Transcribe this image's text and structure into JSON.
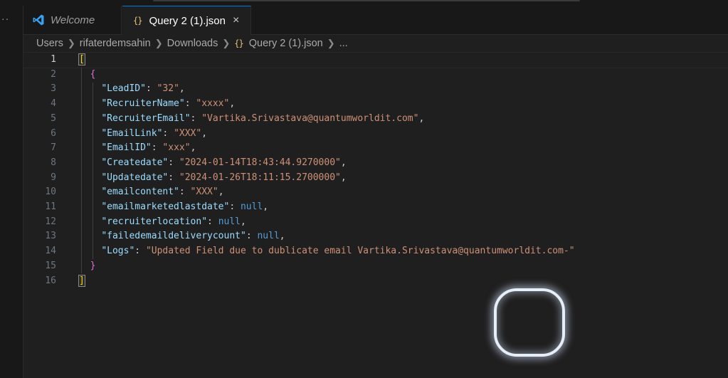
{
  "tabs": [
    {
      "label": "Welcome",
      "active": false
    },
    {
      "label": "Query 2 (1).json",
      "active": true,
      "close": "×"
    }
  ],
  "activity_dots": "··",
  "breadcrumb": [
    "Users",
    "rifaterdemsahin",
    "Downloads",
    "Query 2 (1).json",
    "..."
  ],
  "file_icon": "{}",
  "editor": {
    "lines": [
      {
        "n": "1",
        "tokens": [
          {
            "t": "[",
            "c": "bracket1 bracket-hl"
          }
        ]
      },
      {
        "n": "2",
        "indent": "  ",
        "tokens": [
          {
            "t": "{",
            "c": "bracket2"
          }
        ]
      },
      {
        "n": "3",
        "indent": "    ",
        "tokens": [
          {
            "t": "\"LeadID\"",
            "c": "key"
          },
          {
            "t": ": ",
            "c": "punc"
          },
          {
            "t": "\"32\"",
            "c": "str"
          },
          {
            "t": ",",
            "c": "punc"
          }
        ]
      },
      {
        "n": "4",
        "indent": "    ",
        "tokens": [
          {
            "t": "\"RecruiterName\"",
            "c": "key"
          },
          {
            "t": ": ",
            "c": "punc"
          },
          {
            "t": "\"xxxx\"",
            "c": "str"
          },
          {
            "t": ",",
            "c": "punc"
          }
        ]
      },
      {
        "n": "5",
        "indent": "    ",
        "tokens": [
          {
            "t": "\"RecruiterEmail\"",
            "c": "key"
          },
          {
            "t": ": ",
            "c": "punc"
          },
          {
            "t": "\"Vartika.Srivastava@quantumworldit.com\"",
            "c": "str"
          },
          {
            "t": ",",
            "c": "punc"
          }
        ]
      },
      {
        "n": "6",
        "indent": "    ",
        "tokens": [
          {
            "t": "\"EmailLink\"",
            "c": "key"
          },
          {
            "t": ": ",
            "c": "punc"
          },
          {
            "t": "\"XXX\"",
            "c": "str"
          },
          {
            "t": ",",
            "c": "punc"
          }
        ]
      },
      {
        "n": "7",
        "indent": "    ",
        "tokens": [
          {
            "t": "\"EmailID\"",
            "c": "key"
          },
          {
            "t": ": ",
            "c": "punc"
          },
          {
            "t": "\"xxx\"",
            "c": "str"
          },
          {
            "t": ",",
            "c": "punc"
          }
        ]
      },
      {
        "n": "8",
        "indent": "    ",
        "tokens": [
          {
            "t": "\"Createdate\"",
            "c": "key"
          },
          {
            "t": ": ",
            "c": "punc"
          },
          {
            "t": "\"2024-01-14T18:43:44.9270000\"",
            "c": "str"
          },
          {
            "t": ",",
            "c": "punc"
          }
        ]
      },
      {
        "n": "9",
        "indent": "    ",
        "tokens": [
          {
            "t": "\"Updatedate\"",
            "c": "key"
          },
          {
            "t": ": ",
            "c": "punc"
          },
          {
            "t": "\"2024-01-26T18:11:15.2700000\"",
            "c": "str"
          },
          {
            "t": ",",
            "c": "punc"
          }
        ]
      },
      {
        "n": "10",
        "indent": "    ",
        "tokens": [
          {
            "t": "\"emailcontent\"",
            "c": "key"
          },
          {
            "t": ": ",
            "c": "punc"
          },
          {
            "t": "\"XXX\"",
            "c": "str"
          },
          {
            "t": ",",
            "c": "punc"
          }
        ]
      },
      {
        "n": "11",
        "indent": "    ",
        "tokens": [
          {
            "t": "\"emailmarketedlastdate\"",
            "c": "key"
          },
          {
            "t": ": ",
            "c": "punc"
          },
          {
            "t": "null",
            "c": "kw"
          },
          {
            "t": ",",
            "c": "punc"
          }
        ]
      },
      {
        "n": "12",
        "indent": "    ",
        "tokens": [
          {
            "t": "\"recruiterlocation\"",
            "c": "key"
          },
          {
            "t": ": ",
            "c": "punc"
          },
          {
            "t": "null",
            "c": "kw"
          },
          {
            "t": ",",
            "c": "punc"
          }
        ]
      },
      {
        "n": "13",
        "indent": "    ",
        "tokens": [
          {
            "t": "\"failedemaildeliverycount\"",
            "c": "key"
          },
          {
            "t": ": ",
            "c": "punc"
          },
          {
            "t": "null",
            "c": "kw"
          },
          {
            "t": ",",
            "c": "punc"
          }
        ]
      },
      {
        "n": "14",
        "indent": "    ",
        "tokens": [
          {
            "t": "\"Logs\"",
            "c": "key"
          },
          {
            "t": ": ",
            "c": "punc"
          },
          {
            "t": "\"Updated Field due to dublicate email Vartika.Srivastava@quantumworldit.com-\"",
            "c": "str"
          }
        ]
      },
      {
        "n": "15",
        "indent": "  ",
        "tokens": [
          {
            "t": "}",
            "c": "bracket2"
          }
        ]
      },
      {
        "n": "16",
        "tokens": [
          {
            "t": "]",
            "c": "bracket1 bracket-hl"
          }
        ]
      }
    ],
    "current_line": "1"
  },
  "colors": {
    "editor_bg": "#1f1f1f",
    "key": "#9cdcfe",
    "string": "#ce9178",
    "null": "#569cd6",
    "bracket_outer": "#ffd700",
    "bracket_inner": "#da70d6",
    "active_tab_accent": "#0078d4"
  }
}
